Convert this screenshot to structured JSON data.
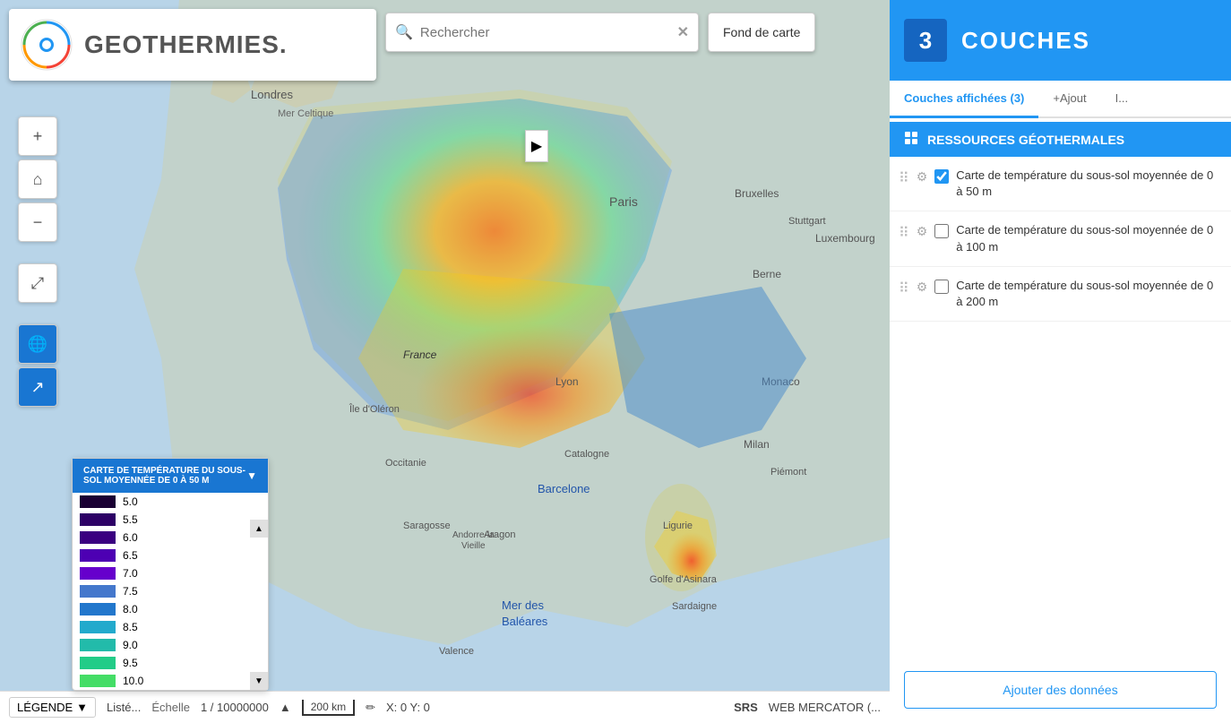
{
  "app": {
    "title": "GEOTHERMIES",
    "logo_text": "GEOTHERMIES."
  },
  "header": {
    "search_placeholder": "Rechercher",
    "fond_carte_label": "Fond de carte"
  },
  "couches_panel": {
    "badge_number": "3",
    "title": "COUCHES",
    "tabs": [
      {
        "label": "Couches affichées (3)",
        "active": true
      },
      {
        "label": "+Ajout",
        "active": false
      },
      {
        "label": "I...",
        "active": false
      }
    ],
    "section_title": "RESSOURCES GÉOTHERMALES",
    "layers": [
      {
        "label": "Carte de température du sous-sol moyennée de 0 à 50 m",
        "checked": true
      },
      {
        "label": "Carte de température du sous-sol moyennée de 0 à 100 m",
        "checked": false
      },
      {
        "label": "Carte de température du sous-sol moyennée de 0 à 200 m",
        "checked": false
      }
    ],
    "add_data_label": "Ajouter des données"
  },
  "legend": {
    "title": "CARTE DE TEMPÉRATURE DU SOUS-SOL MOYENNÉE DE 0 À 50 M",
    "items": [
      {
        "value": "5.0",
        "color": "#1a0033"
      },
      {
        "value": "5.5",
        "color": "#2d0066"
      },
      {
        "value": "6.0",
        "color": "#3a0080"
      },
      {
        "value": "6.5",
        "color": "#4d00b3"
      },
      {
        "value": "7.0",
        "color": "#6600cc"
      },
      {
        "value": "7.5",
        "color": "#4477cc"
      },
      {
        "value": "8.0",
        "color": "#2277cc"
      },
      {
        "value": "8.5",
        "color": "#22aacc"
      },
      {
        "value": "9.0",
        "color": "#22bbaa"
      },
      {
        "value": "9.5",
        "color": "#22cc88"
      },
      {
        "value": "10.0",
        "color": "#44dd66"
      }
    ]
  },
  "bottom_bar": {
    "legende_label": "LÉGENDE",
    "liste_label": "Listé...",
    "echelle_label": "Échelle",
    "scale_fraction": "1 / 10000000",
    "scale_km": "200 km",
    "pencil_icon": "✏",
    "coordinates": "X: 0 Y: 0",
    "srs_label": "SRS",
    "projection": "WEB MERCATOR (..."
  },
  "toolbar": {
    "zoom_in": "+",
    "home": "⌂",
    "zoom_out": "−",
    "fullscreen": "⤢",
    "globe": "🌐",
    "arrow": "↗"
  }
}
